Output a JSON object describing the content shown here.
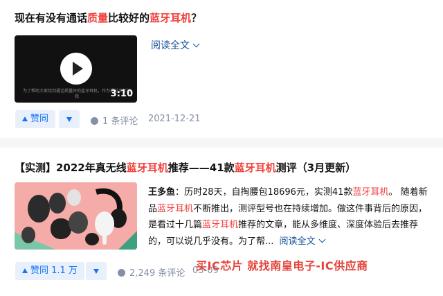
{
  "answer1": {
    "title_parts": [
      "现在有没有通话",
      "质量",
      "比较好的",
      "蓝牙耳机",
      "？"
    ],
    "video": {
      "caption": "为了帮助大家找到通话质量好的蓝牙耳机，作为通过多年的我",
      "duration": "3:10"
    },
    "read_more": "阅读全文",
    "upvote_label": "赞同",
    "comments": "1 条评论",
    "date": "2021-12-21"
  },
  "answer2": {
    "title_parts": [
      "【实测】2022年真无线",
      "蓝牙耳机",
      "推荐——41款",
      "蓝牙耳机",
      "测评（3月更新）"
    ],
    "excerpt": {
      "author": "王多鱼",
      "p1": "：历时28天，自掏腰包18696元，实测41款",
      "h1": "蓝牙耳机",
      "p2": "。 随着新品",
      "h2": "蓝牙耳机",
      "p3": "不断推出，测评型号也在持续增加。做这件事背后的原因，是看过十几篇",
      "h3": "蓝牙耳机",
      "p4": "推荐的文章，能从多维度、深度体验后去推荐的，可以说几乎没有。为了帮..."
    },
    "read_more": "阅读全文",
    "upvote_label": "赞同 1.1 万",
    "comments": "2,249 条评论",
    "date": "03-09"
  },
  "watermark": "买IC芯片 就找南皇电子-IC供应商",
  "colors": {
    "highlight": "#f1403c",
    "link": "#175199",
    "vote_bg": "#e8f0fc",
    "vote_fg": "#1772f6",
    "meta": "#8590a6",
    "watermark": "#e5433a"
  },
  "icons": [
    "play-icon",
    "chevron-down-icon",
    "upvote-triangle-icon",
    "downvote-triangle-icon",
    "comment-bubble-icon"
  ]
}
